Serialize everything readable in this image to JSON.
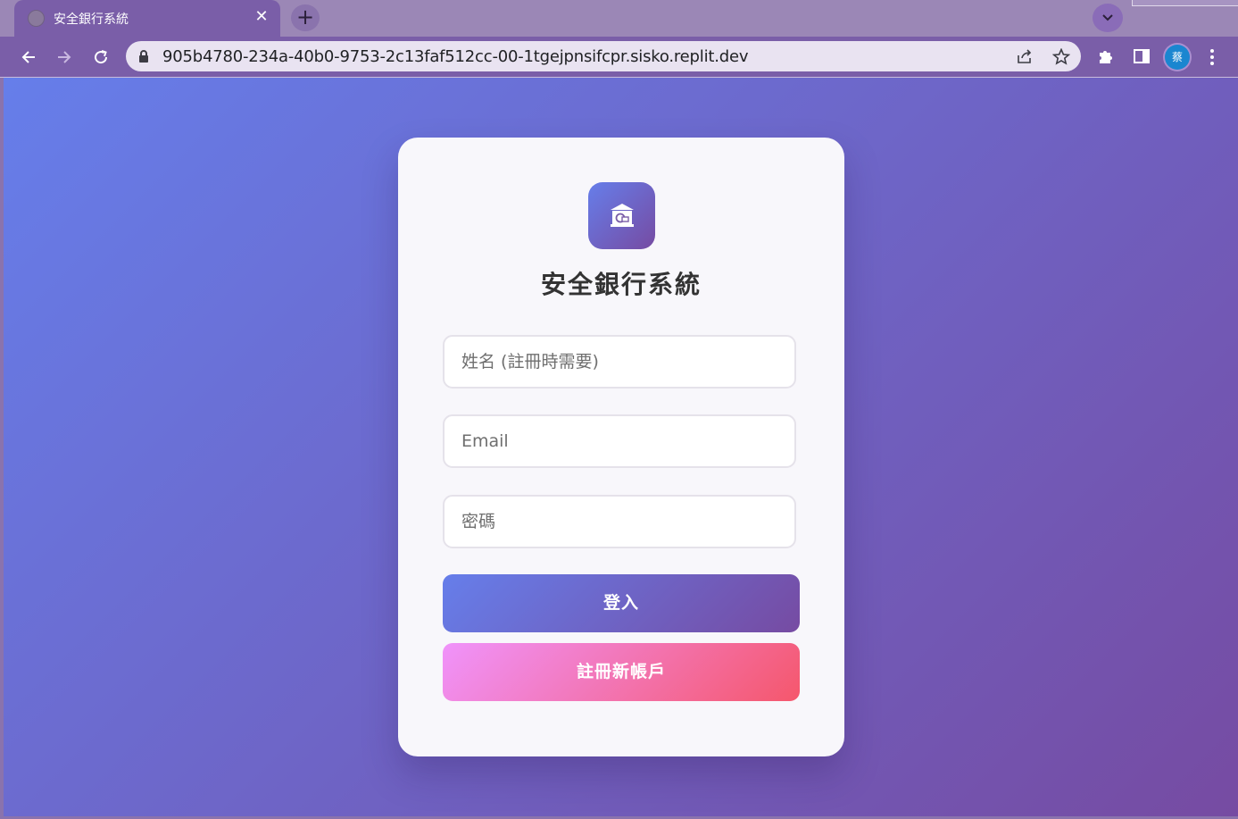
{
  "browser": {
    "tab_title": "安全銀行系統",
    "url": "905b4780-234a-40b0-9753-2c13faf512cc-00-1tgejpnsifcpr.sisko.replit.dev",
    "profile_initial": "蔡"
  },
  "login_card": {
    "title": "安全銀行系統",
    "logo_icon": "bank-icon",
    "name_placeholder": "姓名 (註冊時需要)",
    "email_placeholder": "Email",
    "password_placeholder": "密碼",
    "login_label": "登入",
    "register_label": "註冊新帳戶"
  },
  "colors": {
    "background_gradient": [
      "#667eea",
      "#764ba2"
    ],
    "register_gradient": [
      "#f093fb",
      "#f5576c"
    ],
    "card": "#f8f7fb",
    "title_text": "#333333"
  }
}
